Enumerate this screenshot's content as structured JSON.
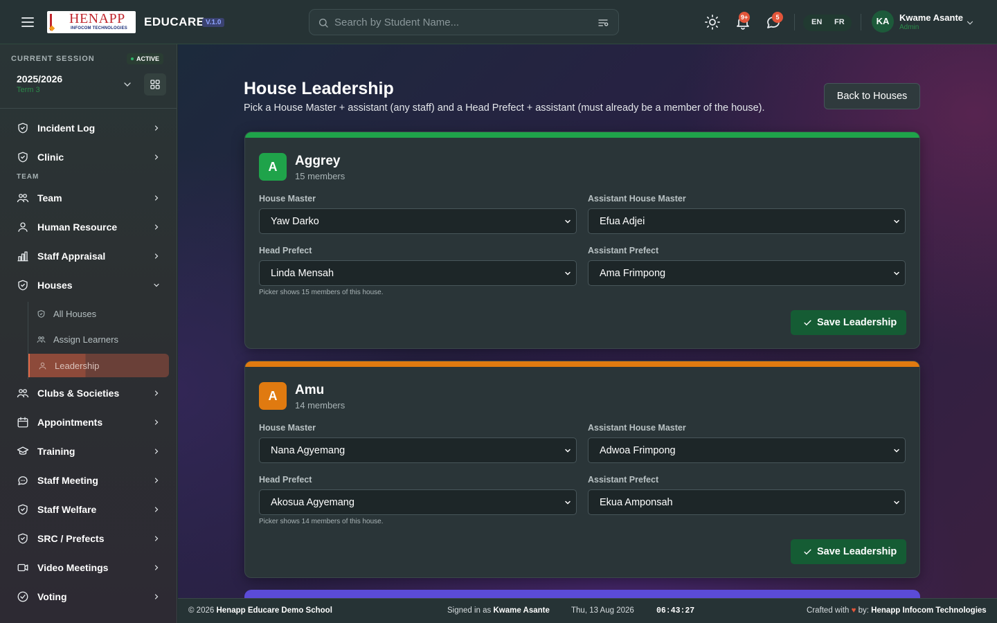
{
  "header": {
    "logo_line1": "HENAPP",
    "logo_line2": "INFOCOM TECHNOLOGIES",
    "brand": "EDUCARE",
    "version": "V.1.0",
    "search_placeholder": "Search by Student Name...",
    "notifications_badge": "9+",
    "messages_badge": "5",
    "lang_en": "EN",
    "lang_fr": "FR",
    "user_initials": "KA",
    "user_name": "Kwame Asante",
    "user_role": "Admin"
  },
  "sidebar": {
    "session_label": "CURRENT SESSION",
    "session_status": "ACTIVE",
    "session_year": "2025/2026",
    "session_term": "Term 3",
    "team_section": "TEAM",
    "items": [
      {
        "label": "Incident Log",
        "icon": "shield-icon"
      },
      {
        "label": "Clinic",
        "icon": "shield-icon"
      },
      {
        "label": "Team",
        "icon": "people-icon"
      },
      {
        "label": "Human Resource",
        "icon": "user-icon"
      },
      {
        "label": "Staff Appraisal",
        "icon": "bar-chart-icon"
      },
      {
        "label": "Houses",
        "icon": "shield-icon"
      },
      {
        "label": "Clubs & Societies",
        "icon": "people-icon"
      },
      {
        "label": "Appointments",
        "icon": "calendar-icon"
      },
      {
        "label": "Training",
        "icon": "graduation-icon"
      },
      {
        "label": "Staff Meeting",
        "icon": "chat-icon"
      },
      {
        "label": "Staff Welfare",
        "icon": "shield-icon"
      },
      {
        "label": "SRC / Prefects",
        "icon": "shield-icon"
      },
      {
        "label": "Video Meetings",
        "icon": "video-icon"
      },
      {
        "label": "Voting",
        "icon": "check-circle-icon"
      }
    ],
    "sub_items": [
      {
        "label": "All Houses"
      },
      {
        "label": "Assign Learners"
      },
      {
        "label": "Leadership"
      }
    ]
  },
  "main": {
    "title": "House Leadership",
    "subtitle": "Pick a House Master + assistant (any staff) and a Head Prefect + assistant (must already be a member of the house).",
    "back_button": "Back to Houses",
    "labels": {
      "house_master": "House Master",
      "assistant_house_master": "Assistant House Master",
      "head_prefect": "Head Prefect",
      "assistant_prefect": "Assistant Prefect",
      "save": "Save Leadership"
    },
    "houses": [
      {
        "initial": "A",
        "name": "Aggrey",
        "members": "15 members",
        "color": "#1fa34a",
        "house_master": "Yaw Darko",
        "assistant_house_master": "Efua Adjei",
        "head_prefect": "Linda Mensah",
        "assistant_prefect": "Ama Frimpong",
        "hint": "Picker shows 15 members of this house."
      },
      {
        "initial": "A",
        "name": "Amu",
        "members": "14 members",
        "color": "#e07a10",
        "house_master": "Nana Agyemang",
        "assistant_house_master": "Adwoa Frimpong",
        "head_prefect": "Akosua Agyemang",
        "assistant_prefect": "Ekua Amponsah",
        "hint": "Picker shows 14 members of this house."
      }
    ],
    "third_card_color": "#5b4bd8"
  },
  "footer": {
    "copyright_prefix": "© 2026",
    "school": "Henapp Educare Demo School",
    "signed_prefix": "Signed in as",
    "signed_user": "Kwame Asante",
    "date": "Thu, 13 Aug 2026",
    "time": "06:43:27",
    "crafted_prefix": "Crafted with",
    "heart": "♥",
    "crafted_by": "by:",
    "company": "Henapp Infocom Technologies"
  }
}
